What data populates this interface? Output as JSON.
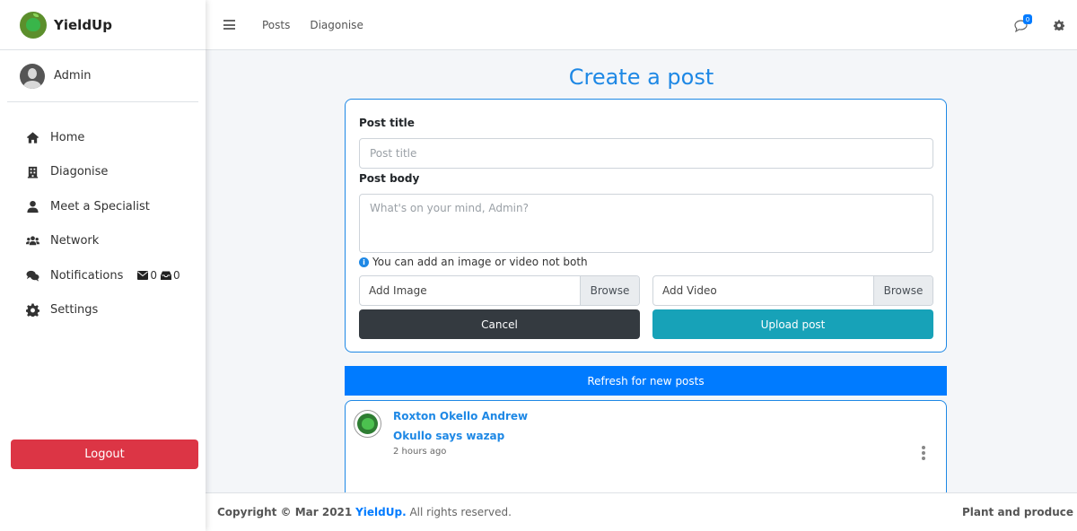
{
  "app": {
    "name": "YieldUp",
    "user": "Admin"
  },
  "sidebar": {
    "items": [
      {
        "label": "Home",
        "icon": "home-icon"
      },
      {
        "label": "Diagonise",
        "icon": "building-icon"
      },
      {
        "label": "Meet a Specialist",
        "icon": "user-icon"
      },
      {
        "label": "Network",
        "icon": "users-icon"
      },
      {
        "label": "Notifications",
        "icon": "comments-icon"
      },
      {
        "label": "Settings",
        "icon": "gear-icon"
      }
    ],
    "notification_badges": {
      "messages": "0",
      "inbox": "0"
    },
    "logout_label": "Logout"
  },
  "topbar": {
    "links": [
      "Posts",
      "Diagonise"
    ],
    "chat_badge": "0"
  },
  "form": {
    "page_title": "Create a post",
    "title_label": "Post title",
    "title_placeholder": "Post title",
    "body_label": "Post body",
    "body_placeholder": "What's on your mind, Admin?",
    "hint": "You can add an image or video not both",
    "add_image_label": "Add Image",
    "add_video_label": "Add Video",
    "browse_label": "Browse",
    "cancel_label": "Cancel",
    "upload_label": "Upload post"
  },
  "feed": {
    "refresh_label": "Refresh for new posts",
    "posts": [
      {
        "author": "Roxton Okello Andrew",
        "title": "Okullo says wazap",
        "time": "2 hours ago"
      }
    ]
  },
  "footer": {
    "copyright": "Copyright © Mar 2021",
    "brand": "YieldUp.",
    "rights": "All rights reserved.",
    "tagline": "Plant and produce"
  },
  "colors": {
    "accent": "#1e88e5",
    "primary": "#007bff",
    "danger": "#dc3545",
    "dark": "#343a40",
    "info": "#17a2b8"
  }
}
